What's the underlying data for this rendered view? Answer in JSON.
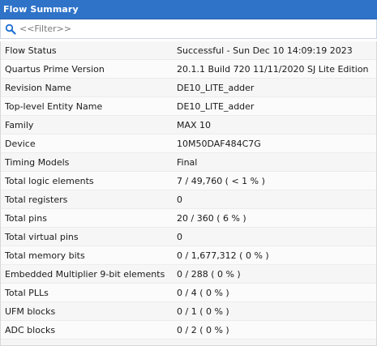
{
  "panel": {
    "title": "Flow Summary"
  },
  "filter": {
    "placeholder": "<<Filter>>",
    "icon": "search-icon"
  },
  "rows": [
    {
      "name": "Flow Status",
      "value": "Successful - Sun Dec 10 14:09:19 2023"
    },
    {
      "name": "Quartus Prime Version",
      "value": "20.1.1 Build 720 11/11/2020 SJ Lite Edition"
    },
    {
      "name": "Revision Name",
      "value": "DE10_LITE_adder"
    },
    {
      "name": "Top-level Entity Name",
      "value": "DE10_LITE_adder"
    },
    {
      "name": "Family",
      "value": "MAX 10"
    },
    {
      "name": "Device",
      "value": "10M50DAF484C7G"
    },
    {
      "name": "Timing Models",
      "value": "Final"
    },
    {
      "name": "Total logic elements",
      "value": "7 / 49,760 ( < 1 % )"
    },
    {
      "name": "Total registers",
      "value": "0"
    },
    {
      "name": "Total pins",
      "value": "20 / 360 ( 6 % )"
    },
    {
      "name": "Total virtual pins",
      "value": "0"
    },
    {
      "name": "Total memory bits",
      "value": "0 / 1,677,312 ( 0 % )"
    },
    {
      "name": "Embedded Multiplier 9-bit elements",
      "value": "0 / 288 ( 0 % )"
    },
    {
      "name": "Total PLLs",
      "value": "0 / 4 ( 0 % )"
    },
    {
      "name": "UFM blocks",
      "value": "0 / 1 ( 0 % )"
    },
    {
      "name": "ADC blocks",
      "value": "0 / 2 ( 0 % )"
    }
  ],
  "colors": {
    "title_bar": "#2f73c9",
    "title_text": "#ffffff",
    "search_icon": "#1f6fd1"
  }
}
